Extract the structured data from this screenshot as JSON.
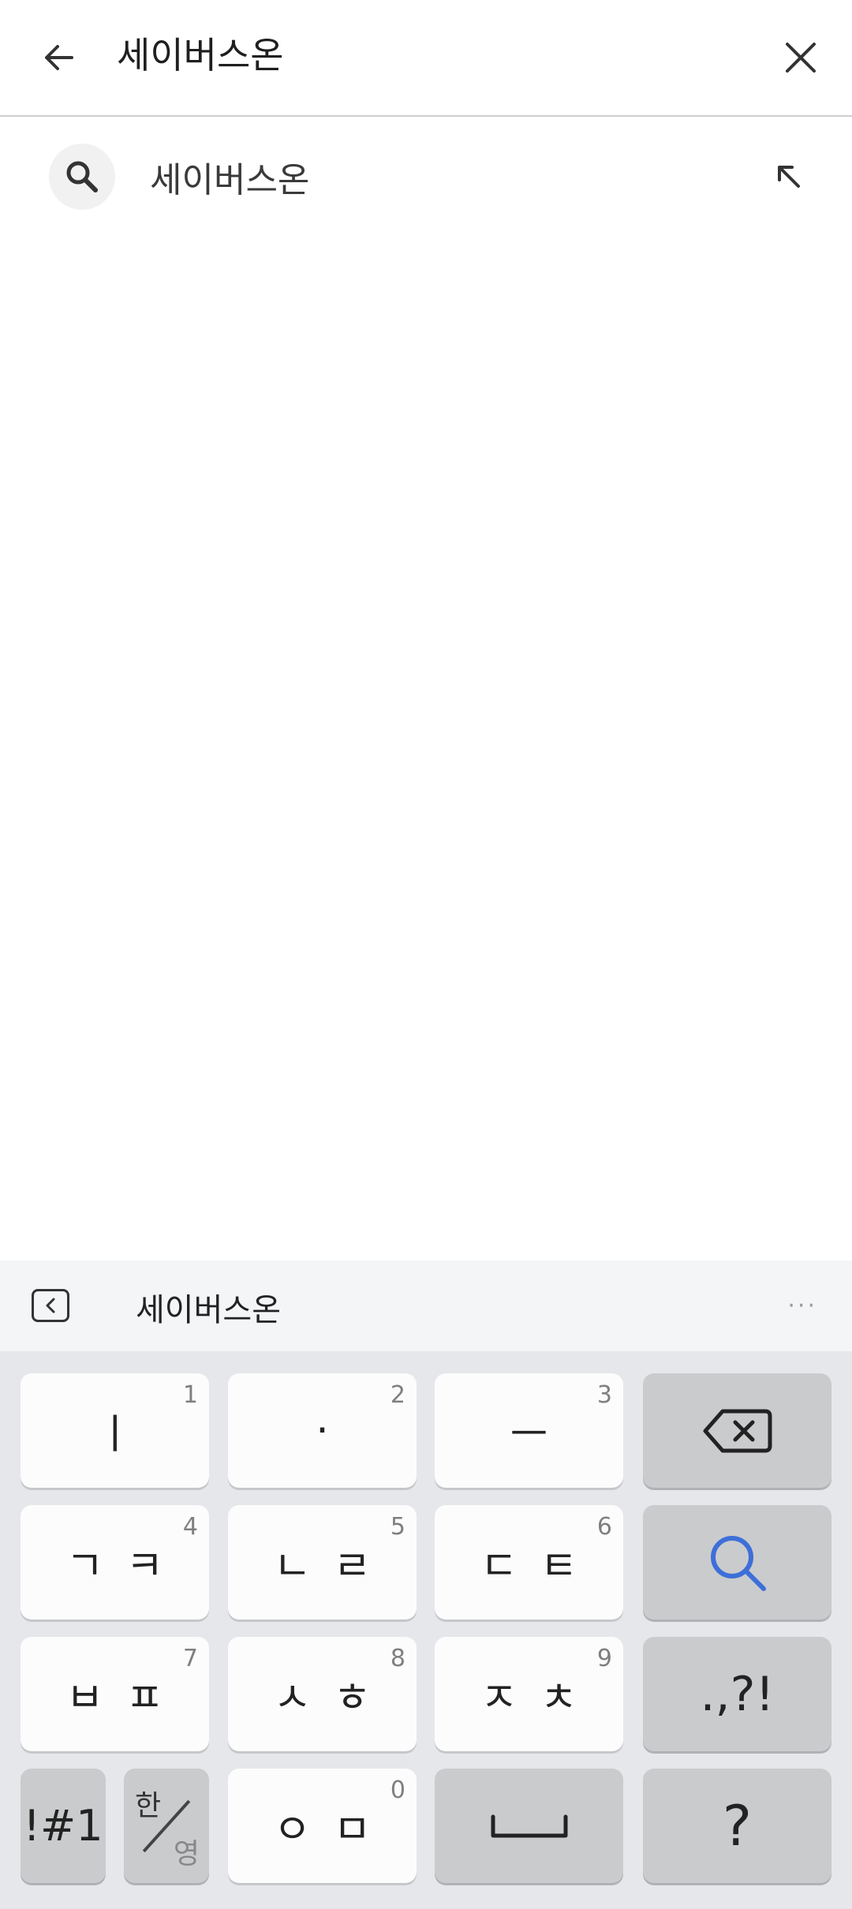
{
  "search": {
    "query": "세이버스온"
  },
  "suggestions": [
    {
      "text": "세이버스온"
    }
  ],
  "keyboard": {
    "prediction": "세이버스온",
    "more": "···",
    "rows": [
      [
        {
          "label": "ㅣ",
          "num": "1"
        },
        {
          "label": "·",
          "num": "2"
        },
        {
          "label": "ㅡ",
          "num": "3"
        },
        {
          "label": "backspace"
        }
      ],
      [
        {
          "label": "ㄱㅋ",
          "num": "4"
        },
        {
          "label": "ㄴㄹ",
          "num": "5"
        },
        {
          "label": "ㄷㅌ",
          "num": "6"
        },
        {
          "label": "search"
        }
      ],
      [
        {
          "label": "ㅂㅍ",
          "num": "7"
        },
        {
          "label": "ㅅㅎ",
          "num": "8"
        },
        {
          "label": "ㅈㅊ",
          "num": "9"
        },
        {
          "label": ".,?!"
        }
      ]
    ],
    "bottom": {
      "symbols": "!#1",
      "lang_top": "한",
      "lang_bottom": "영",
      "om": "ㅇㅁ",
      "om_num": "0",
      "question": "?"
    }
  },
  "colors": {
    "accent": "#3d6fd8",
    "key_light": "#fcfcfc",
    "key_dark": "#cacbcd",
    "keyboard_bg": "#e6e7ea"
  }
}
